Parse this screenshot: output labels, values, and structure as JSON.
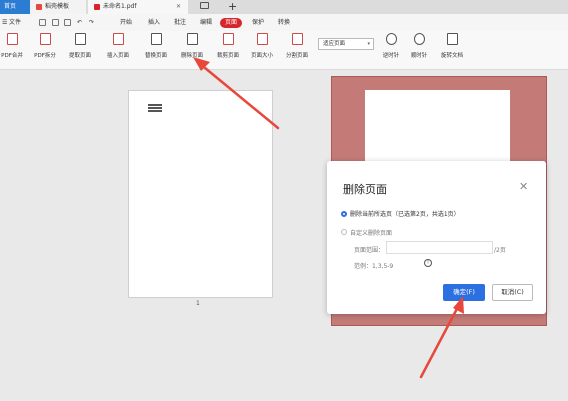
{
  "tabs": {
    "home": "首页",
    "docer": "稻壳模板",
    "pdf": "未命名1.pdf",
    "new_tab": "+"
  },
  "menu": {
    "file": "文件",
    "start": "开始",
    "insert": "插入",
    "annotate": "批注",
    "edit": "编辑",
    "page": "页面",
    "protect": "保护",
    "convert": "转换"
  },
  "toolbar": {
    "pdf_merge": "PDF合并",
    "pdf_split": "PDF拆分",
    "extract_page": "提取页面",
    "insert_page": "插入页面",
    "replace_page": "替换页面",
    "delete_page": "删除页面",
    "crop_page": "裁剪页面",
    "page_size": "页面大小",
    "split_page": "分割页面",
    "zoom_value": "适应页面",
    "rotate_left": "逆时针",
    "rotate_right": "顺时针",
    "rotate_doc": "旋转文档"
  },
  "document": {
    "page1_number": "1"
  },
  "dialog": {
    "title": "删除页面",
    "close": "✕",
    "option1": "删除当前所选页（已选第2页，共选1页）",
    "option2": "自定义删除页面",
    "range_label": "页面范围：",
    "range_value": "",
    "range_total": "/2页",
    "example": "范例：1,3,5-9",
    "ok": "确定(F)",
    "cancel": "取消(C)"
  },
  "colors": {
    "accent_blue": "#2b6fe0",
    "accent_red": "#d7262b",
    "arrow_red": "#e8483c",
    "selected_page": "#c47b78"
  }
}
